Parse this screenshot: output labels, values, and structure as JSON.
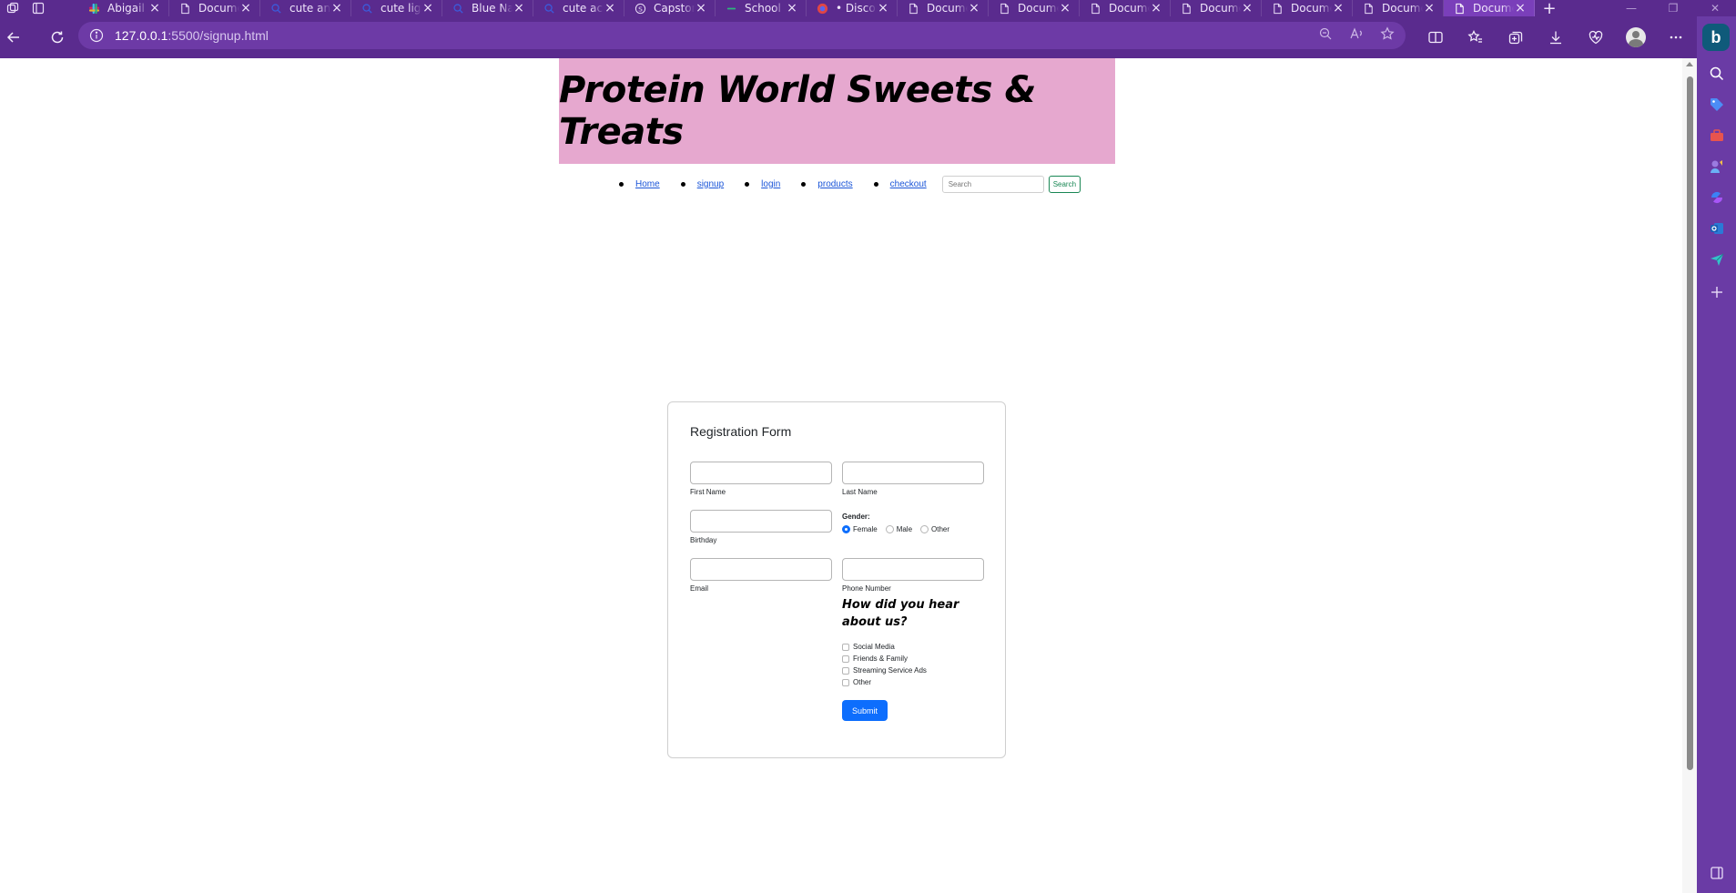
{
  "browser": {
    "tabs": [
      {
        "title": "Abigail",
        "icon": "slack-icon"
      },
      {
        "title": "Document",
        "icon": "document-icon"
      },
      {
        "title": "cute and",
        "icon": "search-icon"
      },
      {
        "title": "cute light",
        "icon": "search-icon"
      },
      {
        "title": "Blue Nails",
        "icon": "search-icon"
      },
      {
        "title": "cute acrylic",
        "icon": "search-icon"
      },
      {
        "title": "Capstone",
        "icon": "s-circle-icon"
      },
      {
        "title": "School",
        "icon": "dash-icon"
      },
      {
        "title": "• Discord",
        "icon": "discord-icon"
      },
      {
        "title": "Document",
        "icon": "document-icon"
      },
      {
        "title": "Document",
        "icon": "document-icon"
      },
      {
        "title": "Document",
        "icon": "document-icon"
      },
      {
        "title": "Document",
        "icon": "document-icon"
      },
      {
        "title": "Document",
        "icon": "document-icon"
      },
      {
        "title": "Document",
        "icon": "document-icon"
      },
      {
        "title": "Document",
        "icon": "document-icon",
        "active": true
      }
    ],
    "url_host": "127.0.0.1",
    "url_path": ":5500/signup.html",
    "colors": {
      "chrome": "#5a2b8e",
      "sidebar": "#6a3ba5"
    }
  },
  "site": {
    "title": "Protein World Sweets & Treats",
    "banner_color": "#e6a8cf",
    "nav": [
      {
        "label": "Home"
      },
      {
        "label": "signup"
      },
      {
        "label": "login"
      },
      {
        "label": "products"
      },
      {
        "label": "checkout"
      }
    ],
    "search_placeholder": "Search",
    "search_button": "Search"
  },
  "form": {
    "title": "Registration Form",
    "first_name_label": "First Name",
    "last_name_label": "Last Name",
    "birthday_label": "Birthday",
    "gender_label": "Gender:",
    "gender_options": [
      {
        "label": "Female",
        "checked": true
      },
      {
        "label": "Male",
        "checked": false
      },
      {
        "label": "Other",
        "checked": false
      }
    ],
    "email_label": "Email",
    "phone_label": "Phone Number",
    "hear_heading": "How did you hear about us?",
    "hear_options": [
      {
        "label": "Social Media"
      },
      {
        "label": "Friends & Family"
      },
      {
        "label": "Streaming Service Ads"
      },
      {
        "label": "Other"
      }
    ],
    "submit_label": "Submit",
    "accent": "#0d6efd"
  }
}
